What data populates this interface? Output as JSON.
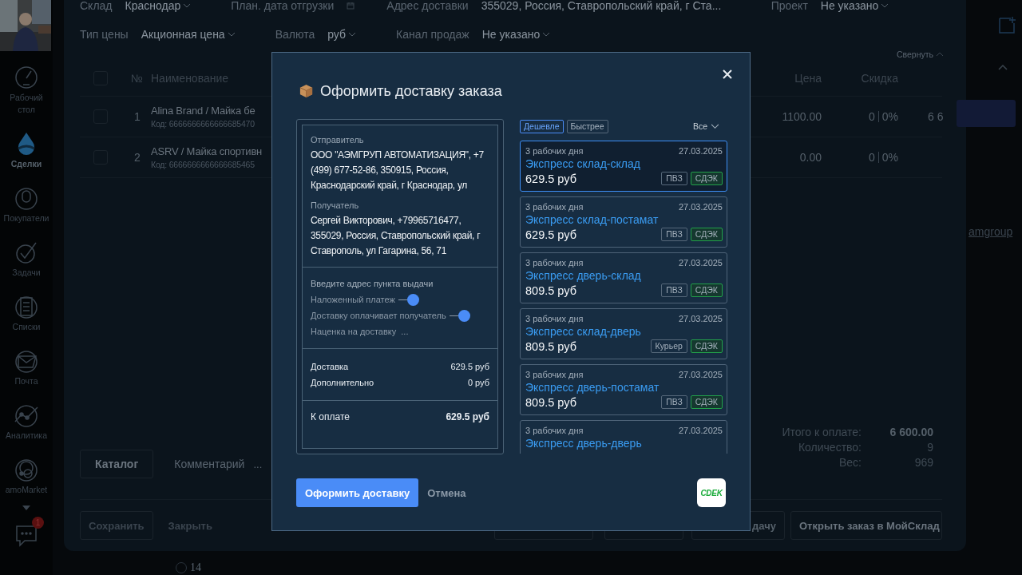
{
  "sidebar": {
    "items": [
      {
        "label": "Рабочий стол",
        "selected": false
      },
      {
        "label": "Сделки",
        "selected": true
      },
      {
        "label": "Покупатели",
        "selected": false
      },
      {
        "label": "Задачи",
        "selected": false
      },
      {
        "label": "Списки",
        "selected": false
      },
      {
        "label": "Почта",
        "selected": false
      },
      {
        "label": "Аналитика",
        "selected": false
      },
      {
        "label": "amoMarket",
        "selected": false
      }
    ],
    "chat_badge": "1"
  },
  "order_form": {
    "fields_row_1": [
      {
        "label": "Склад",
        "value": "Краснодар",
        "kind": "select"
      },
      {
        "label": "План. дата отгрузки",
        "kind": "date"
      },
      {
        "label": "Адрес доставки",
        "value": "355029, Россия, Ставропольский край, г Ста...",
        "kind": "text"
      },
      {
        "label": "Проект",
        "value": "Не указано",
        "kind": "select"
      }
    ],
    "fields_row_2": [
      {
        "label": "Тип цены",
        "value": "Акционная цена",
        "kind": "select"
      },
      {
        "label": "Валюта",
        "value": "руб",
        "kind": "select"
      },
      {
        "label": "Канал продаж",
        "value": "Не указано",
        "kind": "select"
      }
    ],
    "collapse_link": "Свернуть",
    "table": {
      "select_all_checked": false,
      "columns": [
        "№",
        "Наименование",
        "Цена",
        "Скидка"
      ],
      "rows": [
        {
          "checked": false,
          "number": "1",
          "name": "Alina Brand / Майка бе",
          "code": "Код: 6666666666666685470",
          "price": "1100.00",
          "discount": "0",
          "discount_percent": "0%",
          "sum": "6 6"
        },
        {
          "checked": false,
          "number": "2",
          "name": "ASRV / Майка спортивн",
          "code": "Код: 6666666666666685465",
          "price": "0.00",
          "discount": "0",
          "discount_percent": "0%"
        }
      ]
    },
    "tabs": [
      {
        "label": "Каталог",
        "selected": true
      },
      {
        "label": "Комментарий",
        "selected": false
      }
    ],
    "tabs_more": "...",
    "totals": [
      {
        "label": "Итого к оплате:",
        "value": "6 600.00"
      },
      {
        "label": "Количество:",
        "value": "9"
      },
      {
        "label": "Вес:",
        "value": "969"
      }
    ],
    "footer_buttons": [
      {
        "label": "Сохранить",
        "kind": "outlined"
      },
      {
        "label": "Закрыть",
        "kind": "plain"
      },
      {
        "kind": "hidden"
      },
      {
        "kind": "hidden"
      },
      {
        "label": "дачу",
        "kind": "hidden"
      },
      {
        "label": "Открыть заказ в МойСклад",
        "kind": "outlined"
      }
    ],
    "side_link": "amgroup",
    "radio_options": [
      {
        "label": "14",
        "selected": false
      }
    ]
  },
  "dialog": {
    "title": "Оформить доставку заказа",
    "sender_label": "Отправитель",
    "sender": "ООО \"АЭМГРУП АВТОМАТИЗАЦИЯ\", +7 (499) 677-52-86, 350915, Россия, Краснодарский край, г Краснодар, ул",
    "recipient_label": "Получатель",
    "recipient": "Сергей Викторович, +79965716477, 355029, Россия, Ставропольский край, г Ставрополь, ул Гагарина, 56, 71",
    "pickup_prompt": "Введите адрес пункта выдачи",
    "options": [
      {
        "label": "Наложенный платеж",
        "kind": "toggle",
        "on": true
      },
      {
        "label": "Доставку оплачивает получатель",
        "kind": "toggle",
        "on": true
      },
      {
        "label": "Наценка на доставку",
        "kind": "menu",
        "button": "..."
      }
    ],
    "charges": [
      {
        "label": "Доставка",
        "value": "629.5 руб"
      },
      {
        "label": "Дополнительно",
        "value": "0 руб"
      }
    ],
    "total": {
      "label": "К оплате",
      "value": "629.5 руб"
    },
    "sort_filters": [
      {
        "label": "Дешевле",
        "selected": true
      },
      {
        "label": "Быстрее",
        "selected": false
      }
    ],
    "type_filter": "Все",
    "tariffs": [
      {
        "days": "3 рабочих дня",
        "date": "27.03.2025",
        "name": "Экспресс склад-склад",
        "price": "629.5 руб",
        "tags": [
          "ПВЗ",
          "СДЭК"
        ],
        "selected": true
      },
      {
        "days": "3 рабочих дня",
        "date": "27.03.2025",
        "name": "Экспресс склад-постамат",
        "price": "629.5 руб",
        "tags": [
          "ПВЗ",
          "СДЭК"
        ],
        "selected": false
      },
      {
        "days": "3 рабочих дня",
        "date": "27.03.2025",
        "name": "Экспресс дверь-склад",
        "price": "809.5 руб",
        "tags": [
          "ПВЗ",
          "СДЭК"
        ],
        "selected": false
      },
      {
        "days": "3 рабочих дня",
        "date": "27.03.2025",
        "name": "Экспресс склад-дверь",
        "price": "809.5 руб",
        "tags": [
          "Курьер",
          "СДЭК"
        ],
        "selected": false
      },
      {
        "days": "3 рабочих дня",
        "date": "27.03.2025",
        "name": "Экспресс дверь-постамат",
        "price": "809.5 руб",
        "tags": [
          "ПВЗ",
          "СДЭК"
        ],
        "selected": false
      },
      {
        "days": "3 рабочих дня",
        "date": "27.03.2025",
        "name": "Экспресс дверь-дверь",
        "selected": false
      }
    ],
    "submit_button": "Оформить доставку",
    "cancel_button": "Отмена",
    "carrier_logo": "CDEK"
  }
}
